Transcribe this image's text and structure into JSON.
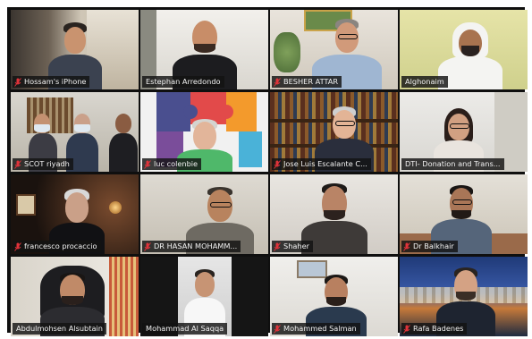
{
  "meeting": {
    "participants": [
      {
        "name": "Hossam's iPhone",
        "muted": true,
        "speaking": false
      },
      {
        "name": "Estephan Arredondo",
        "muted": false,
        "speaking": true
      },
      {
        "name": "BESHER ATTAR",
        "muted": true,
        "speaking": false
      },
      {
        "name": "Alghonaim",
        "muted": false,
        "speaking": false
      },
      {
        "name": "SCOT riyadh",
        "muted": true,
        "speaking": false
      },
      {
        "name": "luc colenbie",
        "muted": true,
        "speaking": false
      },
      {
        "name": "Jose Luis Escalante C...",
        "muted": true,
        "speaking": false
      },
      {
        "name": "DTI- Donation and Trans...",
        "muted": false,
        "speaking": false
      },
      {
        "name": "francesco procaccio",
        "muted": true,
        "speaking": false
      },
      {
        "name": "DR HASAN MOHAMM...",
        "muted": true,
        "speaking": false
      },
      {
        "name": "Shaher",
        "muted": true,
        "speaking": false
      },
      {
        "name": "Dr Balkhair",
        "muted": true,
        "speaking": false
      },
      {
        "name": "Abdulmohsen Alsubtain",
        "muted": false,
        "speaking": false
      },
      {
        "name": "Mohammad Al Saqqa",
        "muted": false,
        "speaking": false
      },
      {
        "name": "Mohammed Salman",
        "muted": true,
        "speaking": false
      },
      {
        "name": "Rafa Badenes",
        "muted": true,
        "speaking": false
      }
    ],
    "colors": {
      "active_speaker_outline": "#d8e86a",
      "muted_icon": "#e0333a",
      "label_background": "#121212",
      "frame_background": "#0f0f0f"
    },
    "icons": {
      "muted": "mic-muted-icon"
    }
  }
}
